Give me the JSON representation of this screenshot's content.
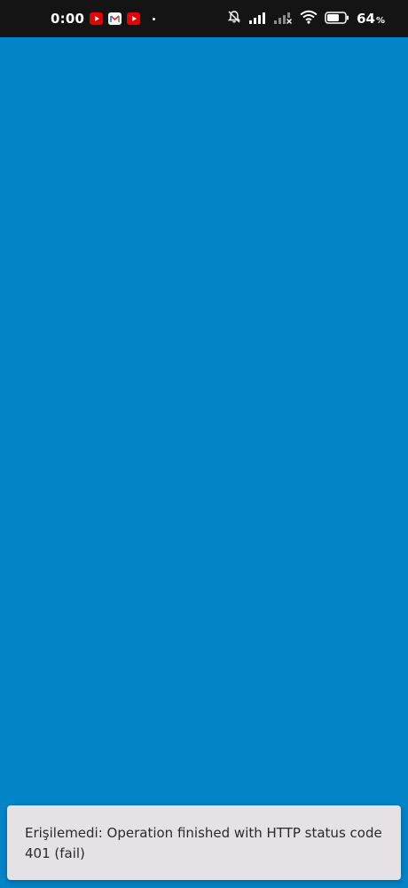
{
  "status_bar": {
    "time": "0:00",
    "notification_icons": [
      "youtube-icon",
      "gmail-icon",
      "youtube-icon"
    ],
    "system_icons": [
      "bell-off-icon",
      "signal-icon",
      "signal-no-service-icon",
      "wifi-icon",
      "battery-icon"
    ],
    "battery_percent": "64",
    "battery_unit": "%"
  },
  "app": {
    "background_color": "#0284c7"
  },
  "snackbar": {
    "message": "Erişilemedi: Operation finished with HTTP status code 401 (fail)"
  }
}
